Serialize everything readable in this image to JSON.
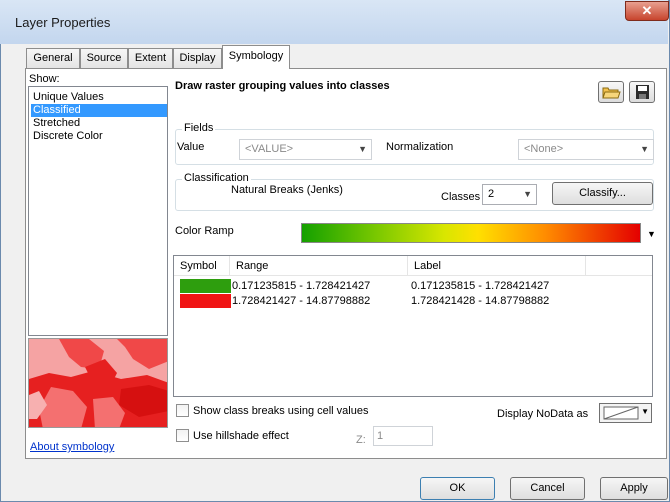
{
  "window": {
    "title": "Layer Properties",
    "close_glyph": "✕"
  },
  "tabs": [
    {
      "label": "General",
      "active": false
    },
    {
      "label": "Source",
      "active": false
    },
    {
      "label": "Extent",
      "active": false
    },
    {
      "label": "Display",
      "active": false
    },
    {
      "label": "Symbology",
      "active": true
    }
  ],
  "show": {
    "label": "Show:",
    "items": [
      "Unique Values",
      "Classified",
      "Stretched",
      "Discrete Color"
    ],
    "selected": "Classified"
  },
  "about_link": "About symbology",
  "heading": "Draw raster grouping values into classes",
  "fields": {
    "group_label": "Fields",
    "value_label": "Value",
    "value_selected": "<VALUE>",
    "normalization_label": "Normalization",
    "normalization_selected": "<None>"
  },
  "classification": {
    "group_label": "Classification",
    "method": "Natural Breaks (Jenks)",
    "classes_label": "Classes",
    "classes_value": "2",
    "classify_button": "Classify..."
  },
  "color_ramp": {
    "label": "Color Ramp"
  },
  "table": {
    "columns": [
      "Symbol",
      "Range",
      "Label"
    ],
    "rows": [
      {
        "color": "#2e9e0e",
        "range": "0.171235815 - 1.728421427",
        "label": "0.171235815 - 1.728421427"
      },
      {
        "color": "#f01414",
        "range": "1.728421427 - 14.87798882",
        "label": "1.728421428 - 14.87798882"
      }
    ]
  },
  "options": {
    "show_breaks_label": "Show class breaks using cell values",
    "hillshade_label": "Use hillshade effect",
    "z_label": "Z:",
    "z_value": "1",
    "nodata_label": "Display NoData as"
  },
  "buttons": {
    "ok": "OK",
    "cancel": "Cancel",
    "apply": "Apply"
  }
}
